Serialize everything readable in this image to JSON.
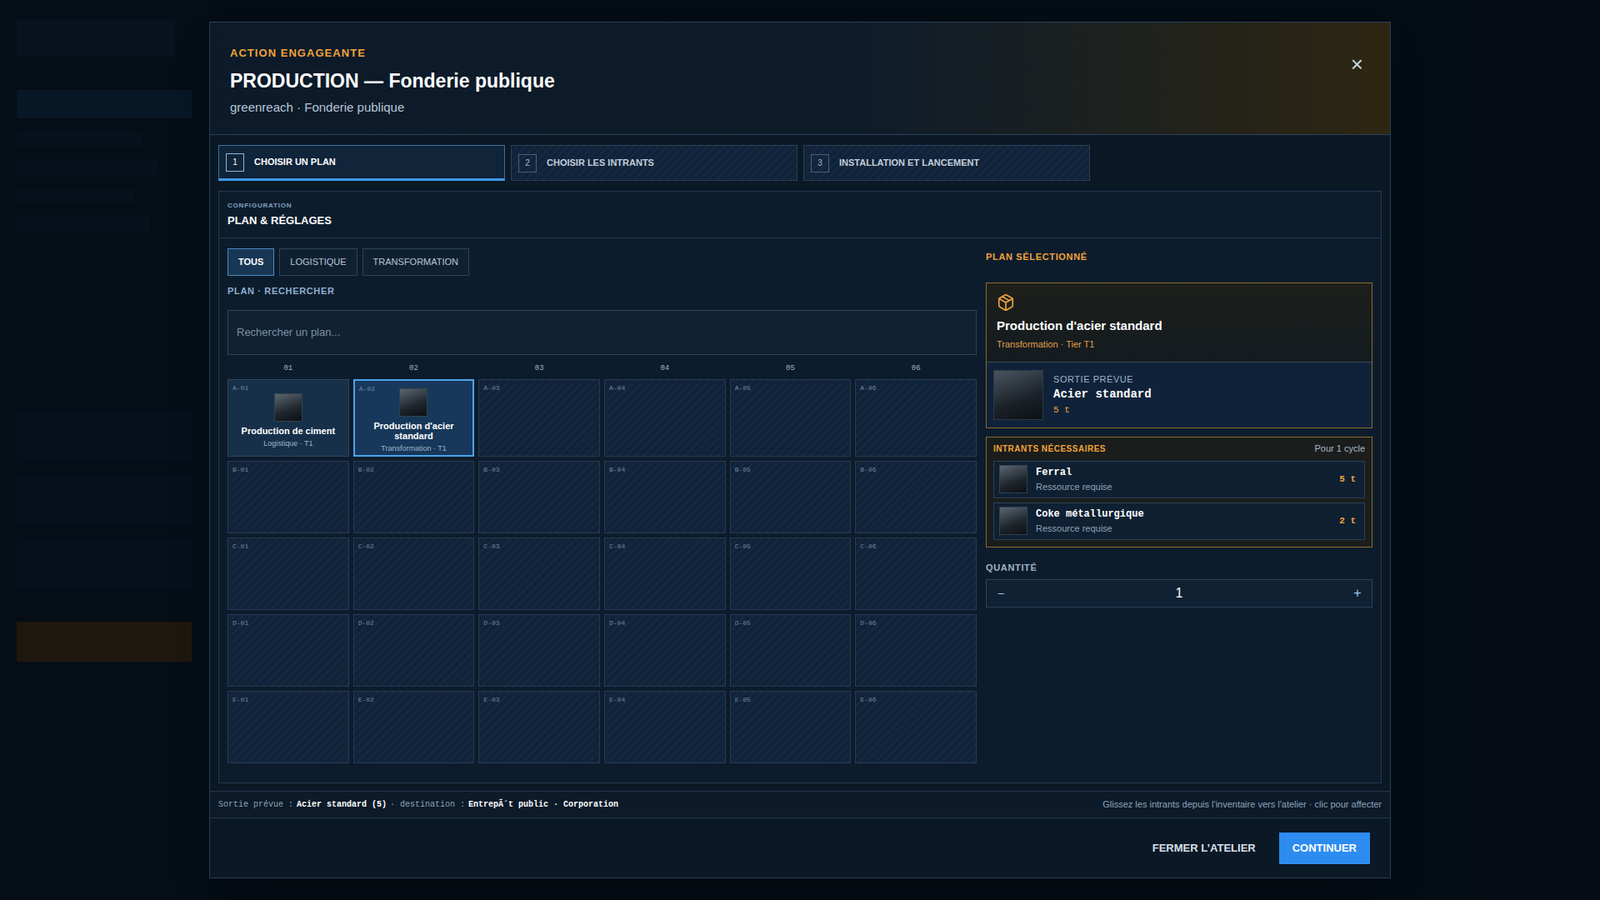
{
  "header": {
    "eyebrow": "ACTION ENGAGEANTE",
    "title": "PRODUCTION — Fonderie publique",
    "subtitle": "greenreach · Fonderie publique",
    "close": "×"
  },
  "steps": [
    {
      "number": "1",
      "label": "CHOISIR UN PLAN",
      "selected": true
    },
    {
      "number": "2",
      "label": "CHOISIR LES INTRANTS",
      "selected": false
    },
    {
      "number": "3",
      "label": "INSTALLATION ET LANCEMENT",
      "selected": false
    }
  ],
  "panel": {
    "eyebrow": "CONFIGURATION",
    "title": "PLAN & RÉGLAGES"
  },
  "filters": [
    {
      "label": "TOUS",
      "selected": true
    },
    {
      "label": "LOGISTIQUE",
      "selected": false
    },
    {
      "label": "TRANSFORMATION",
      "selected": false
    }
  ],
  "search": {
    "label": "PLAN · RECHERCHER",
    "placeholder": "Rechercher un plan..."
  },
  "grid": {
    "columns": [
      "01",
      "02",
      "03",
      "04",
      "05",
      "06"
    ],
    "rows": [
      [
        {
          "id": "A-01",
          "kind": "plan",
          "name": "Production de ciment",
          "meta": "Logistique · T1",
          "selected": false
        },
        {
          "id": "A-02",
          "kind": "plan",
          "name": "Production d'acier standard",
          "meta": "Transformation · T1",
          "selected": true
        },
        {
          "id": "A-03",
          "kind": "empty",
          "selected": false
        },
        {
          "id": "A-04",
          "kind": "empty",
          "selected": false
        },
        {
          "id": "A-05",
          "kind": "empty",
          "selected": false
        },
        {
          "id": "A-06",
          "kind": "empty",
          "selected": false
        }
      ],
      [
        {
          "id": "B-01",
          "kind": "empty",
          "selected": false
        },
        {
          "id": "B-02",
          "kind": "empty",
          "selected": false
        },
        {
          "id": "B-03",
          "kind": "empty",
          "selected": false
        },
        {
          "id": "B-04",
          "kind": "empty",
          "selected": false
        },
        {
          "id": "B-05",
          "kind": "empty",
          "selected": false
        },
        {
          "id": "B-06",
          "kind": "empty",
          "selected": false
        }
      ],
      [
        {
          "id": "C-01",
          "kind": "empty",
          "selected": false
        },
        {
          "id": "C-02",
          "kind": "empty",
          "selected": false
        },
        {
          "id": "C-03",
          "kind": "empty",
          "selected": false
        },
        {
          "id": "C-04",
          "kind": "empty",
          "selected": false
        },
        {
          "id": "C-05",
          "kind": "empty",
          "selected": false
        },
        {
          "id": "C-06",
          "kind": "empty",
          "selected": false
        }
      ],
      [
        {
          "id": "D-01",
          "kind": "empty",
          "selected": false
        },
        {
          "id": "D-02",
          "kind": "empty",
          "selected": false
        },
        {
          "id": "D-03",
          "kind": "empty",
          "selected": false
        },
        {
          "id": "D-04",
          "kind": "empty",
          "selected": false
        },
        {
          "id": "D-05",
          "kind": "empty",
          "selected": false
        },
        {
          "id": "D-06",
          "kind": "empty",
          "selected": false
        }
      ],
      [
        {
          "id": "E-01",
          "kind": "empty",
          "selected": false
        },
        {
          "id": "E-02",
          "kind": "empty",
          "selected": false
        },
        {
          "id": "E-03",
          "kind": "empty",
          "selected": false
        },
        {
          "id": "E-04",
          "kind": "empty",
          "selected": false
        },
        {
          "id": "E-05",
          "kind": "empty",
          "selected": false
        },
        {
          "id": "E-06",
          "kind": "empty",
          "selected": false
        }
      ]
    ]
  },
  "selected_plan": {
    "heading": "PLAN SÉLECTIONNÉ",
    "name": "Production d'acier standard",
    "meta": "Transformation · Tier T1",
    "output_label": "SORTIE PRÉVUE",
    "output_name": "Acier standard",
    "output_qty": "5 t"
  },
  "inputs": {
    "heading": "INTRANTS NÉCESSAIRES",
    "note": "Pour 1 cycle",
    "items": [
      {
        "name": "Ferral",
        "sub": "Ressource requise",
        "qty": "5 t"
      },
      {
        "name": "Coke métallurgique",
        "sub": "Ressource requise",
        "qty": "2 t"
      }
    ]
  },
  "quantity": {
    "label": "QUANTITÉ",
    "value": "1",
    "decrement": "−",
    "increment": "+"
  },
  "status_bar": {
    "parts": [
      {
        "label": "Sortie prévue :",
        "value": "Acier standard (5)"
      },
      {
        "label": "· destination :",
        "value": "EntrepÃ´t public · Corporation"
      }
    ],
    "hint": "Glissez les intrants depuis l'inventaire vers l'atelier · clic pour affecter"
  },
  "buttons": [
    {
      "label": "FERMER L’ATELIER",
      "kind": "secondary"
    },
    {
      "label": "CONTINUER",
      "kind": "primary"
    }
  ]
}
